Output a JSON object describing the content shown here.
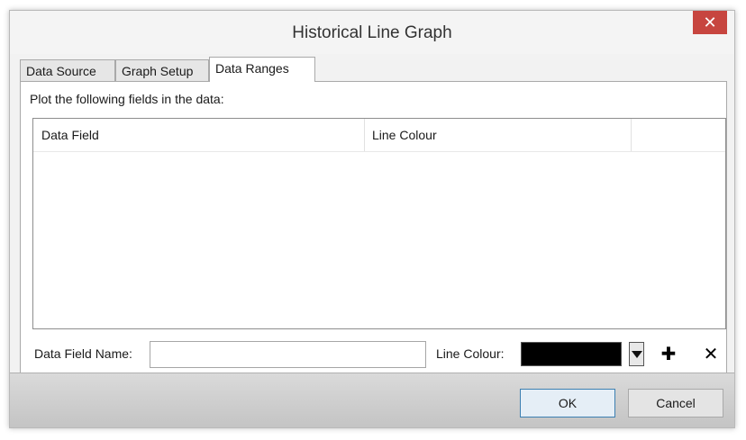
{
  "window": {
    "title": "Historical Line Graph"
  },
  "tabs": [
    {
      "label": "Data Source",
      "active": false
    },
    {
      "label": "Graph Setup",
      "active": false
    },
    {
      "label": "Data Ranges",
      "active": true
    }
  ],
  "panel": {
    "instruction": "Plot the following fields in the data:",
    "columns": [
      "Data Field",
      "Line Colour"
    ],
    "rows": []
  },
  "field_editor": {
    "name_label": "Data Field Name:",
    "name_value": "",
    "colour_label": "Line Colour:",
    "selected_colour": "#000000",
    "add_symbol": "✚",
    "remove_symbol": "✕"
  },
  "footer": {
    "ok_label": "OK",
    "cancel_label": "Cancel"
  },
  "colors": {
    "close_button": "#c7453f",
    "accent": "#3c7fb1"
  }
}
